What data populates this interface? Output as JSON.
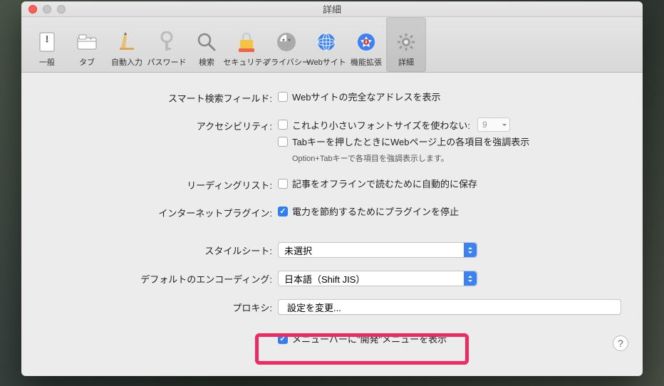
{
  "title": "詳細",
  "toolbar": [
    {
      "name": "general-icon",
      "label": "一般"
    },
    {
      "name": "tabs-icon",
      "label": "タブ"
    },
    {
      "name": "autofill-icon",
      "label": "自動入力"
    },
    {
      "name": "passwords-icon",
      "label": "パスワード"
    },
    {
      "name": "search-icon",
      "label": "検索"
    },
    {
      "name": "security-icon",
      "label": "セキュリティ"
    },
    {
      "name": "privacy-icon",
      "label": "プライバシー"
    },
    {
      "name": "websites-icon",
      "label": "Webサイト"
    },
    {
      "name": "extensions-icon",
      "label": "機能拡張"
    },
    {
      "name": "advanced-icon",
      "label": "詳細",
      "active": true
    }
  ],
  "sections": {
    "smart_search": {
      "label": "スマート検索フィールド:",
      "full_url_checkbox": {
        "checked": false,
        "text": "Webサイトの完全なアドレスを表示"
      }
    },
    "accessibility": {
      "label": "アクセシビリティ:",
      "min_font_checkbox": {
        "checked": false,
        "text": "これより小さいフォントサイズを使わない:"
      },
      "min_font_value": "9",
      "tab_highlight_checkbox": {
        "checked": false,
        "text": "Tabキーを押したときにWebページ上の各項目を強調表示"
      },
      "tab_hint": "Option+Tabキーで各項目を強調表示します。"
    },
    "reading_list": {
      "label": "リーディングリスト:",
      "offline_checkbox": {
        "checked": false,
        "text": "記事をオフラインで読むために自動的に保存"
      }
    },
    "internet_plugins": {
      "label": "インターネットプラグイン:",
      "power_save_checkbox": {
        "checked": true,
        "text": "電力を節約するためにプラグインを停止"
      }
    },
    "stylesheet": {
      "label": "スタイルシート:",
      "value": "未選択"
    },
    "default_encoding": {
      "label": "デフォルトのエンコーディング:",
      "value": "日本語（Shift JIS）"
    },
    "proxy": {
      "label": "プロキシ:",
      "button": "設定を変更..."
    },
    "develop_menu": {
      "checked": true,
      "text": "メニューバーに\"開発\"メニューを表示"
    }
  },
  "help_button": "?"
}
